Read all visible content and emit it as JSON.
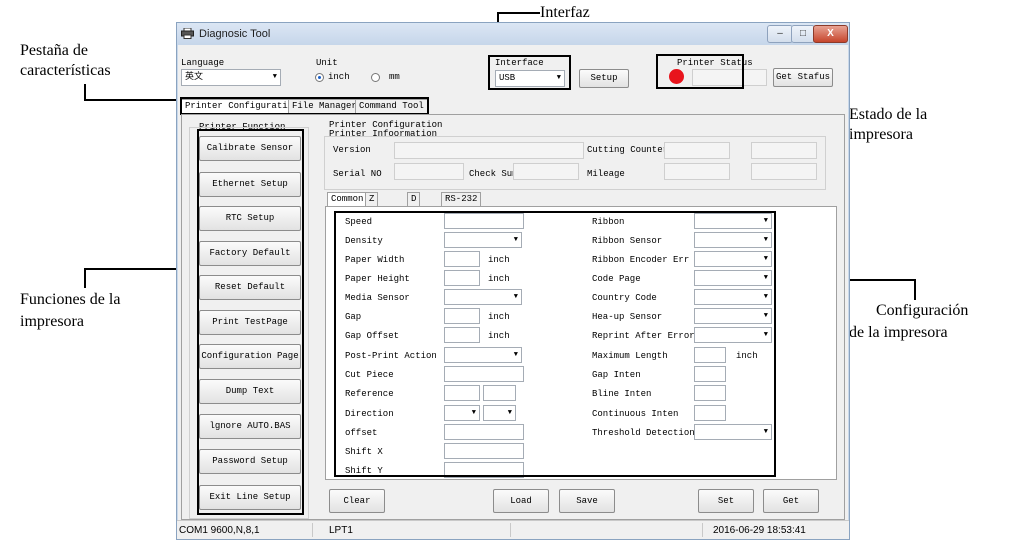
{
  "annotations": {
    "interfaz": "Interfaz",
    "pestana_1": "Pestaña de",
    "pestana_2": "características",
    "estado_1": "Estado de la",
    "estado_2": "impresora",
    "funciones_1": "Funciones de la",
    "funciones_2": "impresora",
    "config_1": "Configuración",
    "config_2": "de la impresora"
  },
  "window": {
    "title": "Diagnosic Tool",
    "minimize": "–",
    "maximize": "□",
    "close": "X"
  },
  "top": {
    "language_label": "Language",
    "language_value": "英文",
    "unit_label": "Unit",
    "unit_inch": "inch",
    "unit_mm": "mm",
    "unit_selected": "inch",
    "interface_label": "Interface",
    "interface_value": "USB",
    "setup_button": "Setup",
    "printer_status_label": "Printer  Status",
    "status_color": "#e8141c",
    "get_status_button": "Get Stafus"
  },
  "tabs": [
    "Printer Configuration",
    "File Manager",
    "Command Tool"
  ],
  "printer_function": {
    "title": "Printer  Function",
    "buttons": [
      "Calibrate Sensor",
      "Ethernet Setup",
      "RTC Setup",
      "Factory Default",
      "Reset Default",
      "Print TestPage",
      "Configuration Page",
      "Dump Text",
      "lgnore AUTO.BAS",
      "Password Setup",
      "Exit Line Setup"
    ]
  },
  "config": {
    "title": "Printer Configuration",
    "info_title": "Printer Infoormation",
    "version": "Version",
    "cutting_counter": "Cutting Counter",
    "serial_no": "Serial NO",
    "check_sum": "Check Sum",
    "mileage": "Mileage"
  },
  "subtabs": [
    "Common",
    "Z",
    "D",
    "RS-232"
  ],
  "common": {
    "speed": "Speed",
    "density": "Density",
    "paper_width": "Paper Width",
    "paper_height": "Paper Height",
    "media_sensor": "Media Sensor",
    "gap": "Gap",
    "gap_offset": "Gap Offset",
    "post_print_action": "Post-Print  Action",
    "cut_piece": "Cut  Piece",
    "reference": "Reference",
    "direction": "Direction",
    "offset": "offset",
    "shift_x": "Shift X",
    "shift_y": "Shift Y",
    "inch": "inch",
    "ribbon": "Ribbon",
    "ribbon_sensor": "Ribbon  Sensor",
    "ribbon_encoder_err": "Ribbon Encoder Err",
    "code_page": "Code Page",
    "country_code": "Country Code",
    "hea_up_sensor": "Hea-up  Sensor",
    "reprint_after_error": "Reprint After  Error",
    "maximum_length": "Maximum Length",
    "gap_inten": "Gap Inten",
    "bline_inten": "Bline  Inten",
    "continuous_inten": "Continuous  Inten",
    "threshold_detection": "Threshold  Detection"
  },
  "bottom_buttons": {
    "clear": "Clear",
    "load": "Load",
    "save": "Save",
    "set": "Set",
    "get": "Get"
  },
  "statusbar": {
    "port": "COM1 9600,N,8,1",
    "lpt": "LPT1",
    "datetime": "2016-06-29  18:53:41"
  }
}
